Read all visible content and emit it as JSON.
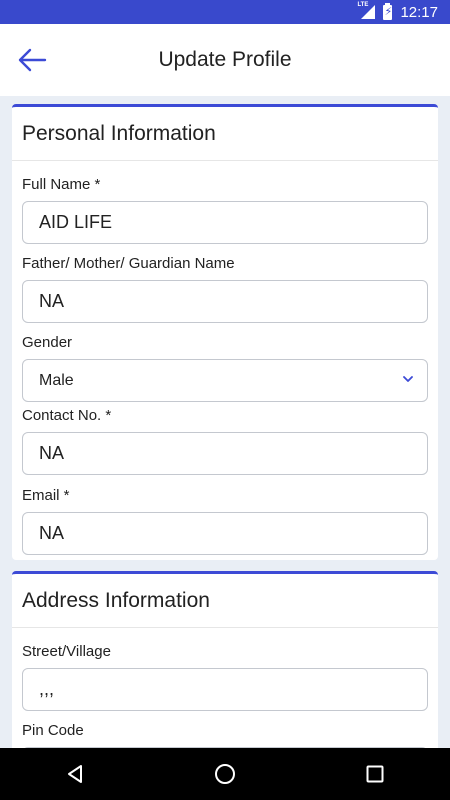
{
  "status_bar": {
    "network": "LTE",
    "time": "12:17"
  },
  "app_bar": {
    "title": "Update Profile"
  },
  "personal": {
    "title": "Personal Information",
    "full_name": {
      "label": "Full Name *",
      "value": "AID LIFE"
    },
    "guardian": {
      "label": "Father/ Mother/ Guardian Name",
      "value": "NA"
    },
    "gender": {
      "label": "Gender",
      "value": "Male"
    },
    "contact": {
      "label": "Contact No. *",
      "value": "NA"
    },
    "email": {
      "label": "Email *",
      "value": "NA"
    }
  },
  "address": {
    "title": "Address Information",
    "street": {
      "label": "Street/Village",
      "value": ",,,"
    },
    "pin": {
      "label": "Pin Code",
      "value": ""
    }
  },
  "colors": {
    "accent": "#3c4ad6",
    "status_bar": "#3949cc",
    "background": "#e9eef5"
  }
}
